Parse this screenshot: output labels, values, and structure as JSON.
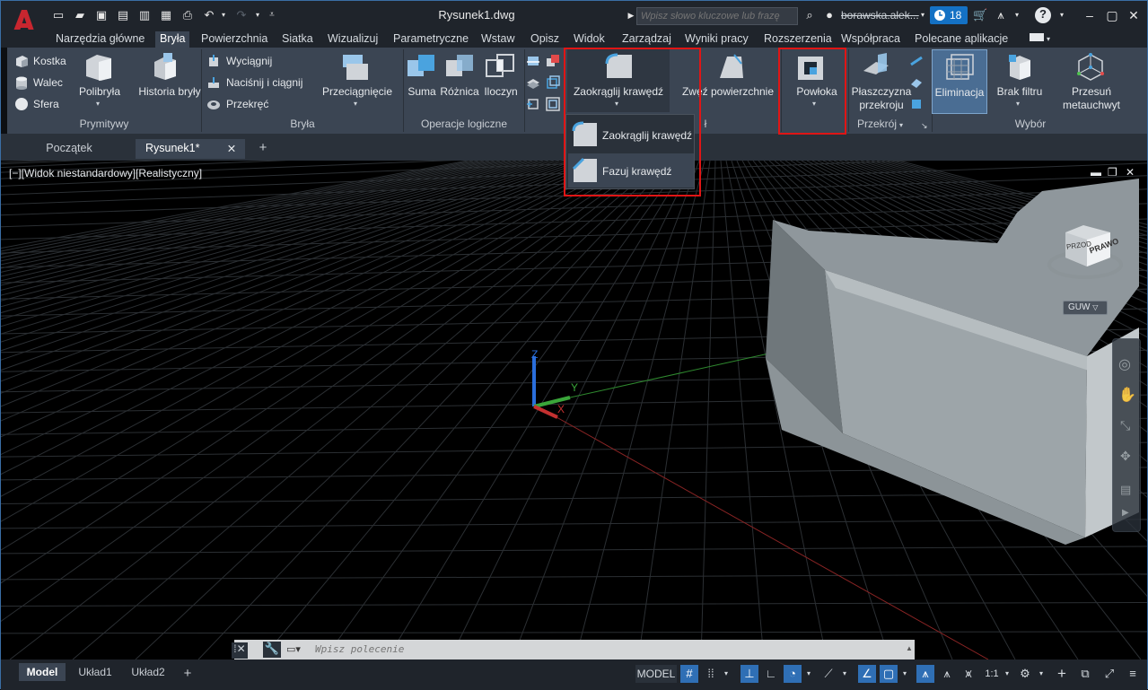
{
  "window": {
    "title": "Rysunek1.dwg"
  },
  "search": {
    "placeholder": "Wpisz słowo kluczowe lub frazę"
  },
  "user": {
    "name": "borawska.alek...",
    "badge_count": "18"
  },
  "menu_tabs": [
    "Narzędzia główne",
    "Bryła",
    "Powierzchnia",
    "Siatka",
    "Wizualizuj",
    "Parametryczne",
    "Wstaw",
    "Opisz",
    "Widok",
    "Zarządzaj",
    "Wyniki pracy",
    "Rozszerzenia",
    "Współpraca",
    "Polecane aplikacje"
  ],
  "ribbon": {
    "prymitywy": {
      "title": "Prymitywy",
      "kostka": "Kostka",
      "walec": "Walec",
      "sfera": "Sfera",
      "polibryla": "Polibryła",
      "historia": "Historia bryły"
    },
    "bryla": {
      "title": "Bryła",
      "wyciagnij": "Wyciągnij",
      "nacisnij": "Naciśnij i ciągnij",
      "przekrec": "Przekręć",
      "przeciagniecie": "Przeciągnięcie"
    },
    "logiczne": {
      "title": "Operacje logiczne",
      "suma": "Suma",
      "roznica": "Różnica",
      "iloczyn": "Iloczyn"
    },
    "edycja": {
      "zaokraglij": "Zaokrąglij krawędź",
      "zwez": "Zwęź powierzchnie",
      "powloka": "Powłoka",
      "title_fragment": "ł"
    },
    "przekroj": {
      "title": "Przekrój",
      "plaszczyzna": "Płaszczyzna przekroju"
    },
    "wybor": {
      "title": "Wybór",
      "eliminacja": "Eliminacja",
      "brak_filtru": "Brak filtru",
      "przesun": "Przesuń metauchwyt"
    }
  },
  "dropdown": {
    "items": [
      "Zaokrąglij krawędź",
      "Fazuj krawędź"
    ]
  },
  "doc_tabs": [
    "Początek",
    "Rysunek1*"
  ],
  "viewport": {
    "label": "[−][Widok niestandardowy][Realistyczny]",
    "viewcube_face_front": "PRZOD",
    "viewcube_face_right": "PRAWO",
    "ucs_label": "GUW",
    "axis_x": "X",
    "axis_y": "Y",
    "axis_z": "Z"
  },
  "command": {
    "placeholder": "Wpisz polecenie"
  },
  "status": {
    "layouts": [
      "Model",
      "Układ1",
      "Układ2"
    ],
    "model": "MODEL",
    "scale": "1:1"
  }
}
